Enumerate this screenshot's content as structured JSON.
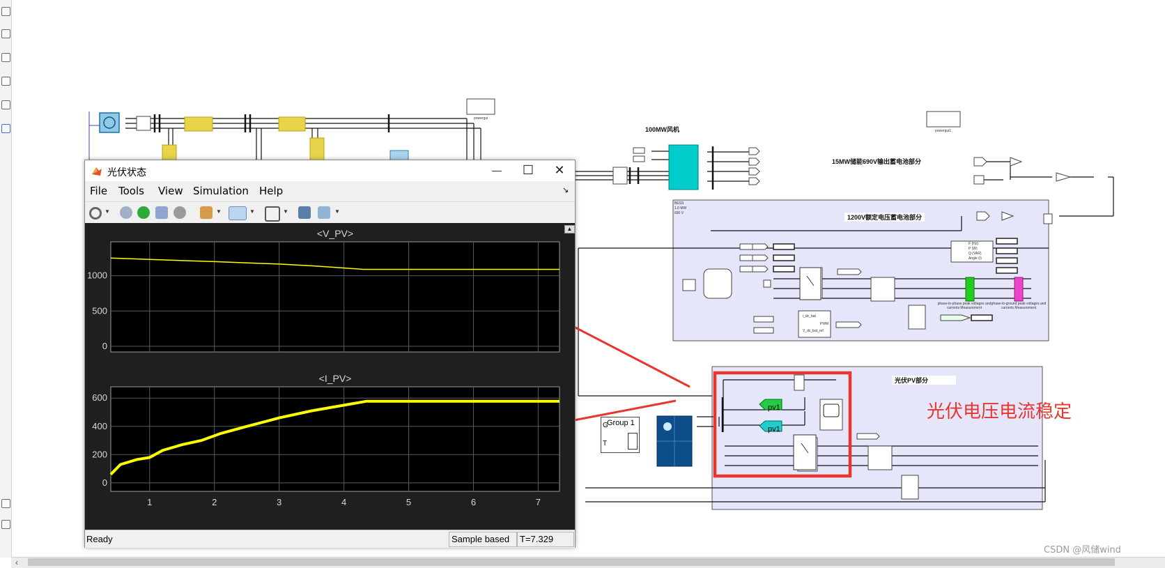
{
  "window": {
    "title": "光伏状态",
    "minimize_glyph": "—",
    "maximize_glyph": "☐",
    "close_glyph": "✕",
    "menu": [
      "File",
      "Tools",
      "View",
      "Simulation",
      "Help"
    ],
    "toolbar_icons": [
      "settings-icon",
      "step-back-icon",
      "run-icon",
      "step-forward-icon",
      "stop-icon",
      "signal-icon",
      "zoom-xy-icon",
      "fit-icon",
      "highlight-icon",
      "measure-icon"
    ]
  },
  "plots": [
    {
      "title": "<V_PV>",
      "yticks": [
        "1000",
        "500",
        "0"
      ]
    },
    {
      "title": "<I_PV>",
      "yticks": [
        "600",
        "400",
        "200",
        "0"
      ]
    }
  ],
  "xticks": [
    "1",
    "2",
    "3",
    "4",
    "5",
    "6",
    "7"
  ],
  "chart_data": [
    {
      "type": "line",
      "title": "<V_PV>",
      "xlim": [
        0.4,
        7.329
      ],
      "ylim": [
        -80,
        1480
      ],
      "series": [
        {
          "x": [
            0.4,
            1.0,
            2.0,
            3.0,
            3.5,
            4.0,
            4.3,
            5.0,
            6.0,
            7.0,
            7.329
          ],
          "y": [
            1250,
            1230,
            1200,
            1165,
            1140,
            1110,
            1090,
            1090,
            1090,
            1090,
            1090
          ]
        }
      ]
    },
    {
      "type": "line",
      "title": "<I_PV>",
      "xlim": [
        0.4,
        7.329
      ],
      "ylim": [
        -60,
        680
      ],
      "series": [
        {
          "x": [
            0.4,
            0.55,
            0.8,
            1.0,
            1.2,
            1.5,
            1.8,
            2.1,
            2.5,
            3.0,
            3.5,
            4.0,
            4.35,
            5.0,
            6.0,
            7.0,
            7.329
          ],
          "y": [
            60,
            130,
            165,
            180,
            230,
            270,
            300,
            350,
            400,
            460,
            510,
            550,
            578,
            578,
            578,
            578,
            578
          ]
        }
      ]
    }
  ],
  "statusbar": {
    "ready": "Ready",
    "mode": "Sample based",
    "time": "T=7.329"
  },
  "diagram": {
    "wind_label": "100MW风机",
    "storage690_label": "15MW储能690V输出蓄电池部分",
    "battery1200_label": "1200V额定电压蓄电池部分",
    "pv_label": "光伏PV部分",
    "annotation": "光伏电压电流稳定",
    "group_block": {
      "name": "Group 1",
      "port1": "G",
      "port2": "T"
    },
    "pv1_tag": "pv1",
    "bess_lines": [
      "BESS",
      "1.0 MW",
      "690 V"
    ],
    "powergui": "powergui",
    "powergui1": "powergui1",
    "meas1": "phase-to-phase peak voltages and currents Measurement",
    "meas2": "phase-to-ground peak voltages and currents Measurement",
    "pwm": "PWM",
    "sig_in1": "i_dc_bat",
    "sig_in2": "V_dc_bat_ref",
    "pq_labels": [
      "F (Hz)",
      "P (W)",
      "Q (VAR)",
      "Angle (I)"
    ]
  },
  "watermark": "CSDN @风储wind",
  "colors": {
    "annotation": "#e8352d",
    "pv_box": "#e8352d",
    "subsystem_fill": "#e6e6fa",
    "wind_block": "#00cccc",
    "plot_bg": "#000000",
    "trace": "#ffff00"
  }
}
